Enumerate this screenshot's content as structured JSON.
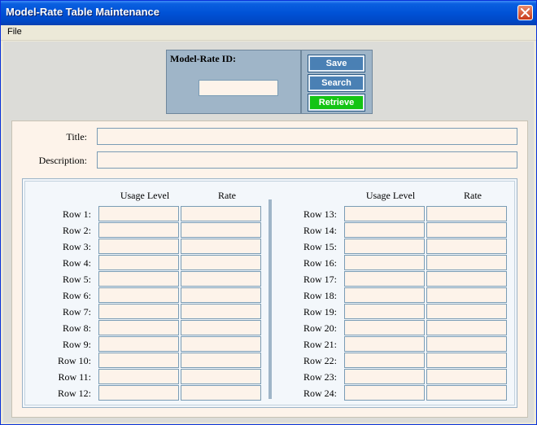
{
  "window": {
    "title": "Model-Rate Table Maintenance"
  },
  "menu": {
    "file": "File"
  },
  "id_panel": {
    "label": "Model-Rate ID:",
    "value": ""
  },
  "buttons": {
    "save": "Save",
    "search": "Search",
    "retrieve": "Retrieve"
  },
  "form": {
    "title_label": "Title:",
    "title_value": "",
    "description_label": "Description:",
    "description_value": ""
  },
  "grid": {
    "left_headers": {
      "usage": "Usage Level",
      "rate": "Rate"
    },
    "right_headers": {
      "usage": "Usage Level",
      "rate": "Rate"
    },
    "left_rows": [
      "Row 1:",
      "Row 2:",
      "Row 3:",
      "Row 4:",
      "Row 5:",
      "Row 6:",
      "Row 7:",
      "Row 8:",
      "Row 9:",
      "Row 10:",
      "Row 11:",
      "Row 12:"
    ],
    "right_rows": [
      "Row 13:",
      "Row 14:",
      "Row 15:",
      "Row 16:",
      "Row 17:",
      "Row 18:",
      "Row 19:",
      "Row 20:",
      "Row 21:",
      "Row 22:",
      "Row 23:",
      "Row 24:"
    ]
  },
  "colors": {
    "panel": "#9fb5c8",
    "field_bg": "#fdf3ea",
    "button_blue": "#4a80b4",
    "button_green": "#14c414"
  }
}
